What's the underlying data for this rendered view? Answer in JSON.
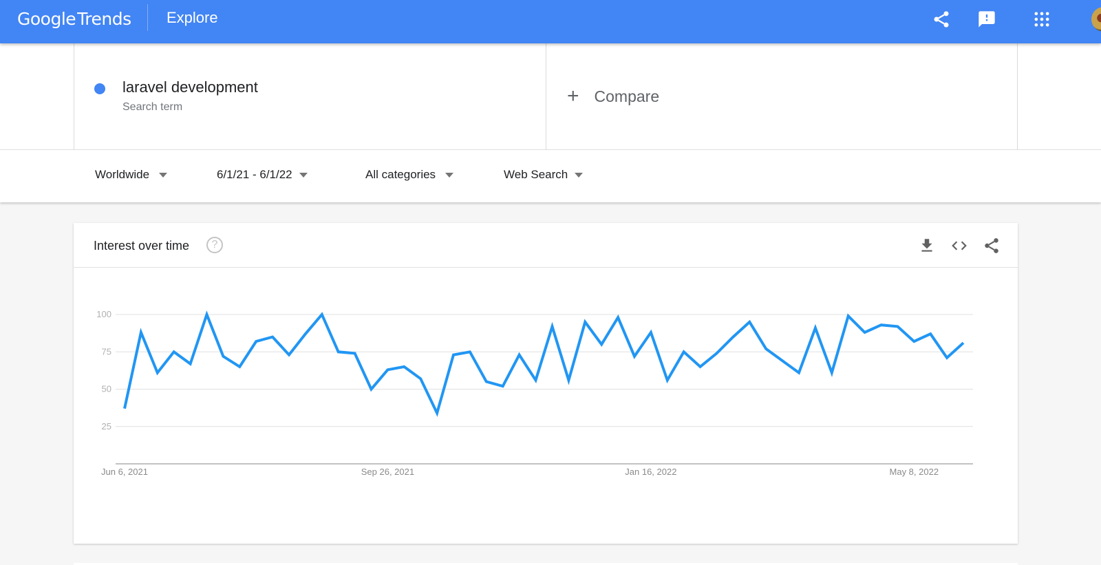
{
  "header": {
    "logo_google": "Google",
    "logo_trends": "Trends",
    "title": "Explore",
    "icons": [
      "share-icon",
      "feedback-icon",
      "apps-grid-icon",
      "account-avatar"
    ],
    "brand_color": "#4285f4"
  },
  "search_terms": [
    {
      "name": "laravel development",
      "type": "Search term",
      "color": "#4285f4"
    }
  ],
  "compare": {
    "icon": "plus-icon",
    "label": "Compare"
  },
  "filters": [
    {
      "label": "Worldwide"
    },
    {
      "label": "6/1/21 - 6/1/22"
    },
    {
      "label": "All categories"
    },
    {
      "label": "Web Search"
    }
  ],
  "card": {
    "title": "Interest over time",
    "help_icon": "?",
    "actions": [
      "download-icon",
      "embed-code-icon",
      "share-icon"
    ]
  },
  "chart_data": {
    "type": "line",
    "title": "Interest over time",
    "xlabel": "",
    "ylabel": "",
    "ylim": [
      0,
      100
    ],
    "yticks": [
      25,
      50,
      75,
      100
    ],
    "xtick_labels": [
      {
        "index": 0,
        "label": "Jun 6, 2021"
      },
      {
        "index": 16,
        "label": "Sep 26, 2021"
      },
      {
        "index": 32,
        "label": "Jan 16, 2022"
      },
      {
        "index": 48,
        "label": "May 8, 2022"
      }
    ],
    "grid": true,
    "legend": "none",
    "series": [
      {
        "name": "laravel development",
        "color": "#2196f3",
        "values": [
          37,
          88,
          61,
          75,
          67,
          100,
          72,
          65,
          82,
          85,
          73,
          87,
          100,
          75,
          74,
          50,
          63,
          65,
          57,
          34,
          73,
          75,
          55,
          52,
          73,
          56,
          92,
          56,
          95,
          80,
          98,
          72,
          88,
          56,
          75,
          65,
          74,
          85,
          95,
          77,
          69,
          61,
          91,
          61,
          99,
          88,
          93,
          92,
          82,
          87,
          71,
          81
        ]
      }
    ]
  }
}
